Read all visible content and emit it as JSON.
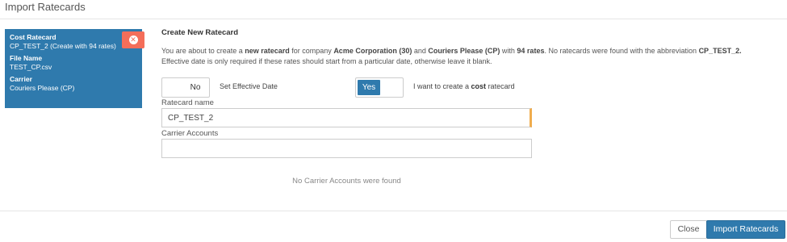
{
  "modal": {
    "title": "Import Ratecards"
  },
  "card": {
    "cost_ratecard_label": "Cost Ratecard",
    "cost_ratecard_value": "CP_TEST_2 (Create with 94 rates)",
    "file_name_label": "File Name",
    "file_name_value": "TEST_CP.csv",
    "carrier_label": "Carrier",
    "carrier_value": "Couriers Please (CP)",
    "remove_icon": "close-circle-icon",
    "remove_glyph": "✕",
    "colors": {
      "background": "#2f7aad",
      "remove_button": "#f46e5a"
    }
  },
  "main": {
    "title": "Create New Ratecard",
    "desc": {
      "p1": "You are about to create a ",
      "b1": "new ratecard",
      "p2": " for company ",
      "b2": "Acme Corporation (30)",
      "p3": " and ",
      "b3": "Couriers Please (CP)",
      "p4": " with ",
      "b4": "94 rates",
      "p5": ". No ratecards were found with the abbreviation ",
      "b5": "CP_TEST_2.",
      "p6": "Effective date is only required if these rates should start from a particular date, otherwise leave it blank."
    },
    "effective_date_toggle": "No",
    "effective_date_label": "Set Effective Date",
    "cost_toggle": "Yes",
    "cost_label_pre": "I want to create a ",
    "cost_label_bold": "cost",
    "cost_label_post": " ratecard",
    "ratecard_name_label": "Ratecard name",
    "ratecard_name_value": "CP_TEST_2",
    "carrier_accounts_label": "Carrier Accounts",
    "carrier_accounts_value": "",
    "no_accounts_msg": "No Carrier Accounts were found"
  },
  "footer": {
    "close_label": "Close",
    "import_label": "Import Ratecards"
  },
  "colors": {
    "primary": "#2f7aad",
    "warning_accent": "#f0ad4e"
  }
}
